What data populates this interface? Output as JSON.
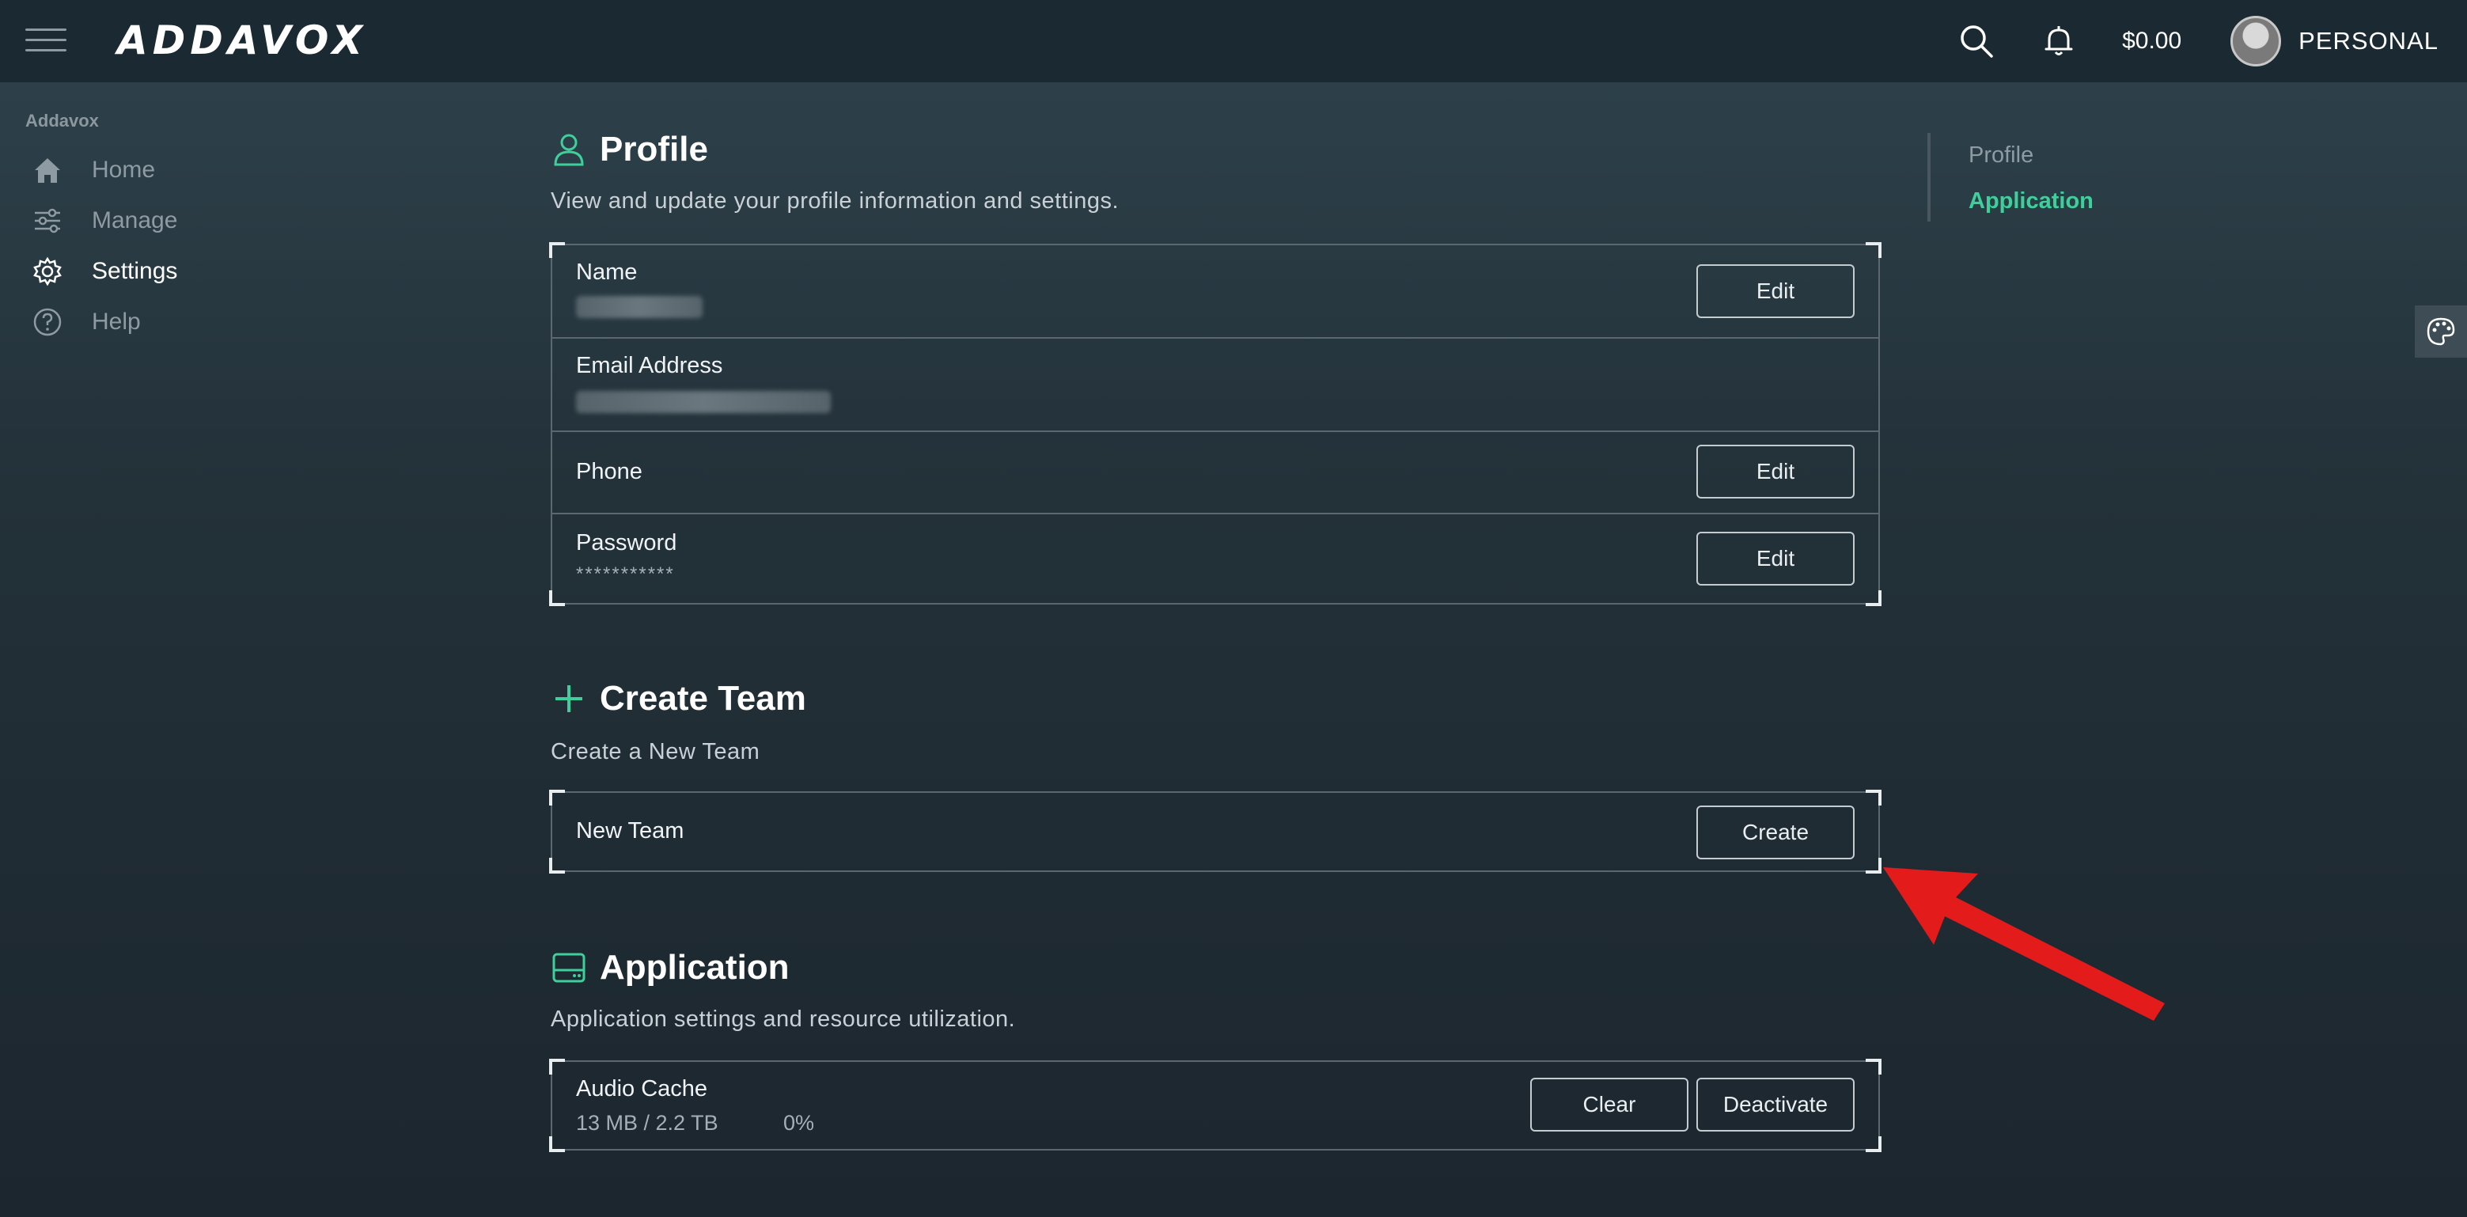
{
  "topbar": {
    "logo": "ADDAVOX",
    "balance": "$0.00",
    "account": "PERSONAL",
    "icons": [
      "menu-icon",
      "search-icon",
      "bell-icon",
      "avatar"
    ]
  },
  "sidebar": {
    "title": "Addavox",
    "items": [
      {
        "label": "Home",
        "icon": "home-icon"
      },
      {
        "label": "Manage",
        "icon": "sliders-icon"
      },
      {
        "label": "Settings",
        "icon": "gear-icon",
        "active": true
      },
      {
        "label": "Help",
        "icon": "help-icon"
      }
    ]
  },
  "profile": {
    "title": "Profile",
    "subtitle": "View and update your profile information and settings.",
    "rows": [
      {
        "label": "Name",
        "button": "Edit"
      },
      {
        "label": "Email Address"
      },
      {
        "label": "Phone",
        "button": "Edit"
      },
      {
        "label": "Password",
        "value": "***********",
        "button": "Edit"
      }
    ]
  },
  "create_team": {
    "title": "Create Team",
    "subtitle": "Create a New Team",
    "row": {
      "label": "New Team",
      "button": "Create"
    }
  },
  "application": {
    "title": "Application",
    "subtitle": "Application settings and resource utilization.",
    "row": {
      "label": "Audio Cache",
      "usage": "13 MB / 2.2 TB",
      "percent": "0%",
      "clear_button": "Clear",
      "deactivate_button": "Deactivate"
    }
  },
  "right_nav": {
    "items": [
      {
        "label": "Profile"
      },
      {
        "label": "Application",
        "active": true
      }
    ]
  },
  "colors": {
    "accent": "#3ecf9a",
    "topbar": "#1b2932",
    "annotation_arrow": "#e31b1b"
  }
}
